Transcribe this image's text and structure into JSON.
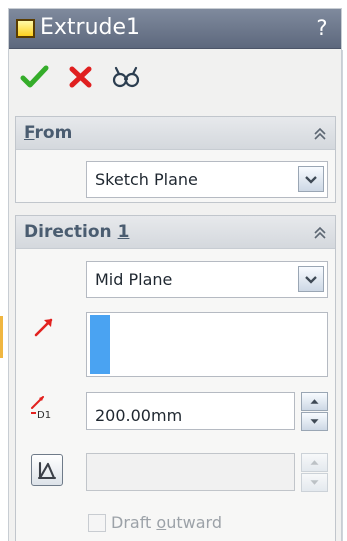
{
  "window": {
    "title": "Extrude1",
    "help_label": "?"
  },
  "actions": {
    "ok": "ok",
    "cancel": "cancel",
    "preview": "preview"
  },
  "from_section": {
    "title": "From",
    "start_condition": "Sketch Plane"
  },
  "direction_section": {
    "title_prefix": "Direction ",
    "title_number": "1",
    "end_condition": "Mid Plane",
    "depth": "200.00mm",
    "depth_icon_label": "D1",
    "draft_value": "",
    "draft_outward_label_prefix": "Draft ",
    "draft_outward_label_underlined": "o",
    "draft_outward_label_suffix": "utward"
  },
  "colors": {
    "accent_blue": "#4aa3f2",
    "title_gray": "#5d687d",
    "ok_green": "#35ad2a",
    "cancel_red": "#e01f1f",
    "direction_red": "#e2221f"
  },
  "icons": {
    "part": "part-icon",
    "ok": "checkmark-icon",
    "cancel": "x-icon",
    "preview": "eyeglasses-icon",
    "collapse": "double-chevron-up-icon",
    "dropdown": "chevron-down-icon",
    "direction": "direction-arrow-icon",
    "depth": "dimension-icon",
    "draft": "draft-icon"
  }
}
